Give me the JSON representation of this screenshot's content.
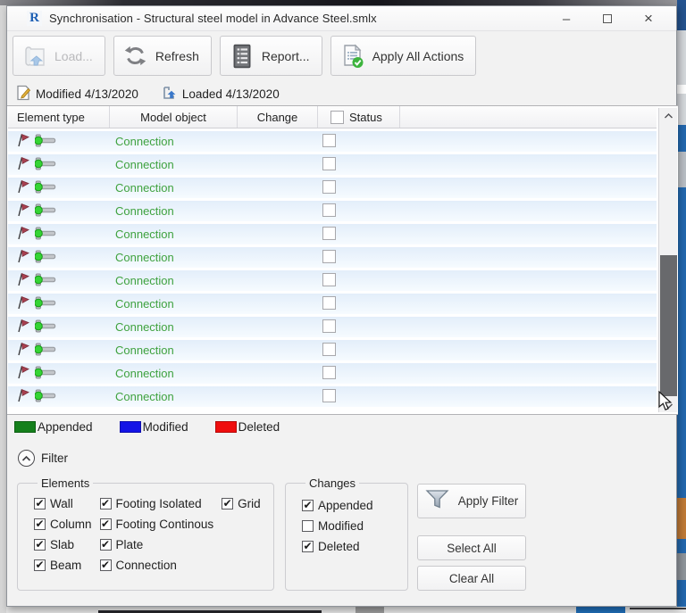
{
  "window": {
    "title": "Synchronisation - Structural steel model in Advance Steel.smlx",
    "icon_letter": "R",
    "minimize_glyph": "–",
    "close_glyph": "×"
  },
  "toolbar": {
    "load_label": "Load...",
    "refresh_label": "Refresh",
    "report_label": "Report...",
    "apply_all_label": "Apply All Actions"
  },
  "status": {
    "modified_label": "Modified 4/13/2020",
    "loaded_label": "Loaded 4/13/2020"
  },
  "table": {
    "columns": [
      "Element type",
      "Model object",
      "Change",
      "Status"
    ],
    "header_checkbox_checked": false,
    "rows": [
      {
        "model_object": "Connection",
        "status_checked": false
      },
      {
        "model_object": "Connection",
        "status_checked": false
      },
      {
        "model_object": "Connection",
        "status_checked": false
      },
      {
        "model_object": "Connection",
        "status_checked": false
      },
      {
        "model_object": "Connection",
        "status_checked": false
      },
      {
        "model_object": "Connection",
        "status_checked": false
      },
      {
        "model_object": "Connection",
        "status_checked": false
      },
      {
        "model_object": "Connection",
        "status_checked": false
      },
      {
        "model_object": "Connection",
        "status_checked": false
      },
      {
        "model_object": "Connection",
        "status_checked": false
      },
      {
        "model_object": "Connection",
        "status_checked": false
      },
      {
        "model_object": "Connection",
        "status_checked": false
      }
    ]
  },
  "legend": [
    {
      "label": "Appended",
      "color": "#15801c"
    },
    {
      "label": "Modified",
      "color": "#1414e6"
    },
    {
      "label": "Deleted",
      "color": "#ef0e0e"
    }
  ],
  "filter": {
    "label": "Filter",
    "elements_group": {
      "label": "Elements",
      "items": [
        {
          "label": "Wall",
          "checked": true
        },
        {
          "label": "Column",
          "checked": true
        },
        {
          "label": "Slab",
          "checked": true
        },
        {
          "label": "Beam",
          "checked": true
        },
        {
          "label": "Footing Isolated",
          "checked": true
        },
        {
          "label": "Footing Continous",
          "checked": true
        },
        {
          "label": "Plate",
          "checked": true
        },
        {
          "label": "Connection",
          "checked": true
        },
        {
          "label": "Grid",
          "checked": true
        }
      ]
    },
    "changes_group": {
      "label": "Changes",
      "items": [
        {
          "label": "Appended",
          "checked": true
        },
        {
          "label": "Modified",
          "checked": false
        },
        {
          "label": "Deleted",
          "checked": true
        }
      ]
    },
    "buttons": {
      "apply_filter": "Apply Filter",
      "select_all": "Select All",
      "clear_all": "Clear All"
    }
  },
  "colors": {
    "connection_text": "#3fa23f",
    "row_tint": "#e3eefa",
    "legend_green": "#15801c",
    "legend_blue": "#1414e6",
    "legend_red": "#ef0e0e",
    "revit_blue": "#1d5fb4"
  }
}
